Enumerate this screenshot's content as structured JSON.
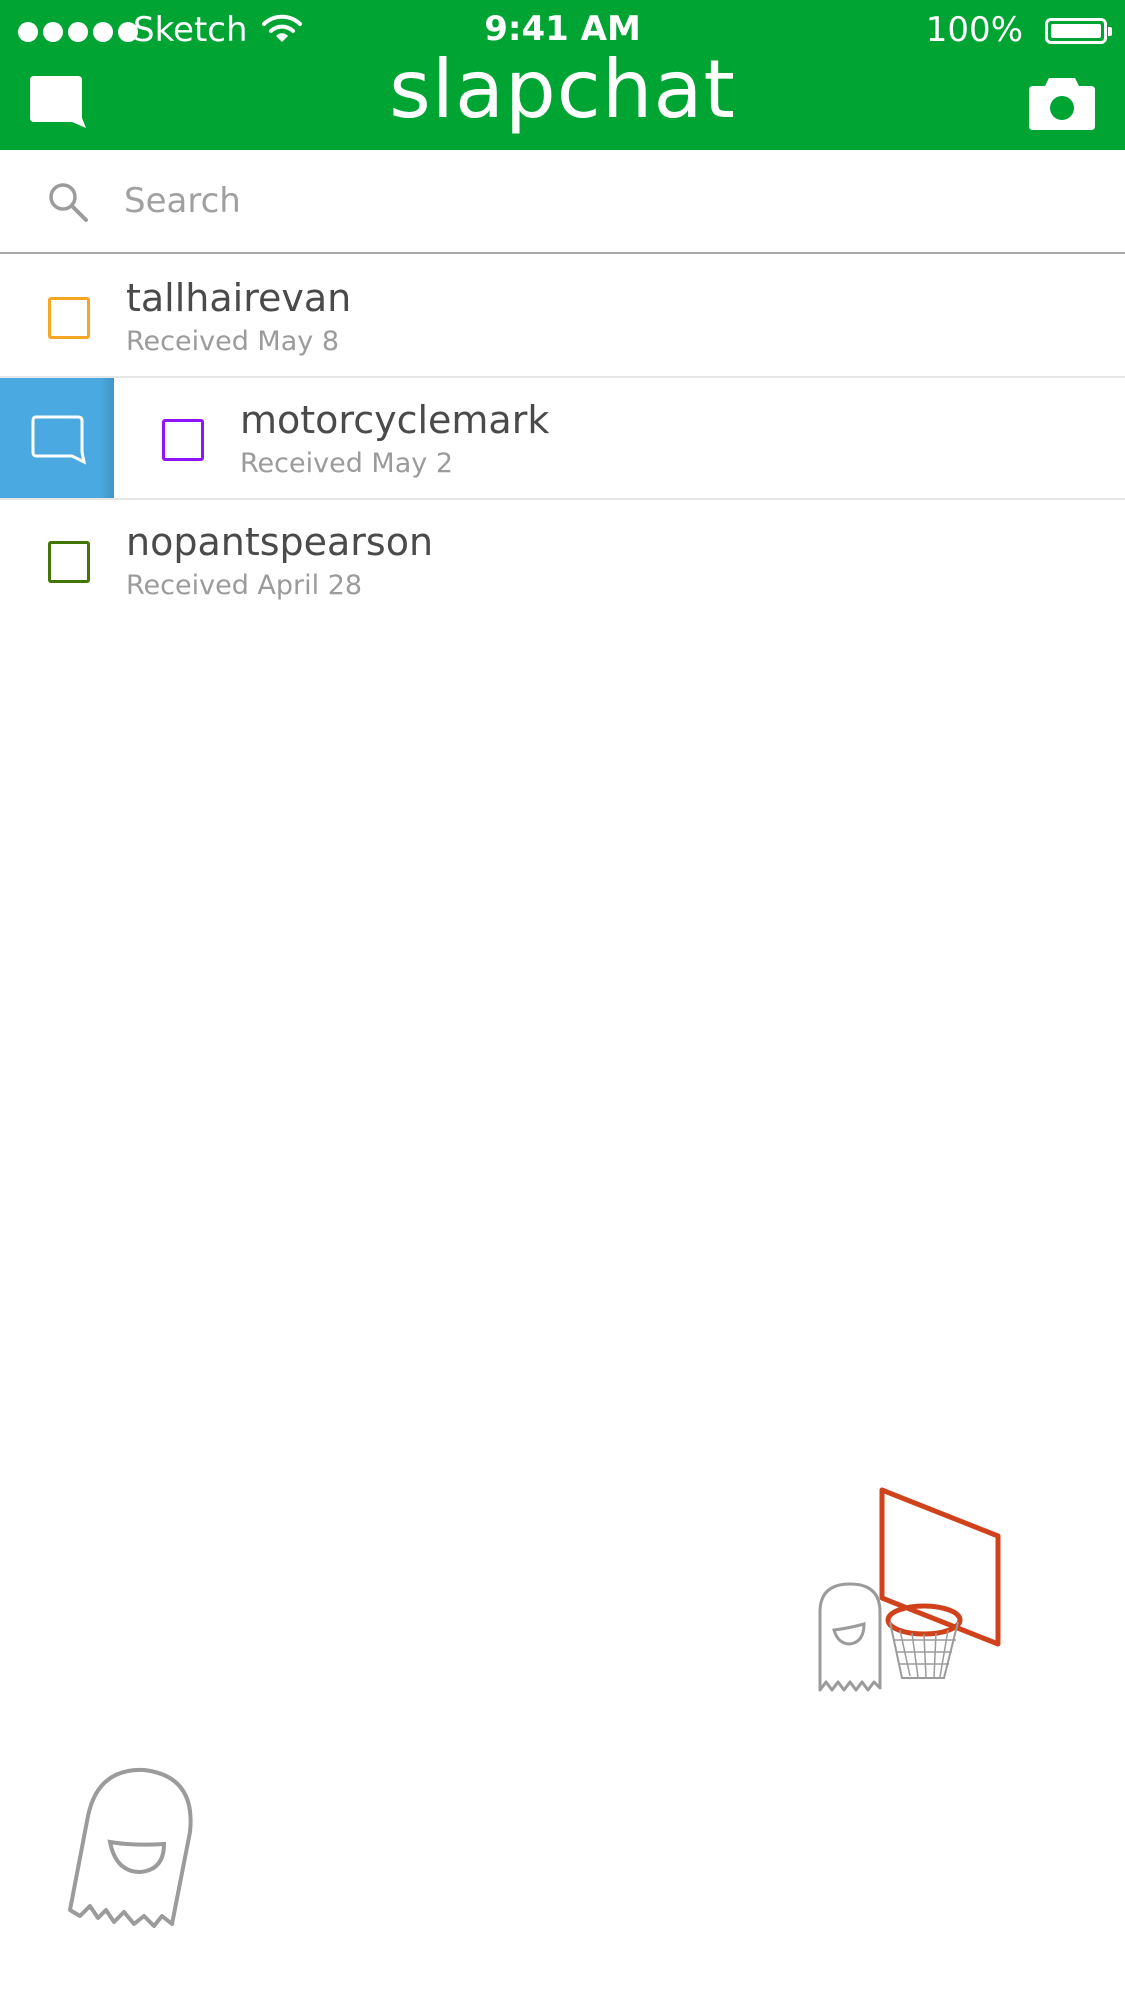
{
  "status_bar": {
    "carrier": "Sketch",
    "time": "9:41 AM",
    "battery": "100%"
  },
  "header": {
    "title": "slapchat",
    "left_icon": "chat-bubble-icon",
    "right_icon": "camera-icon"
  },
  "search": {
    "placeholder": "Search",
    "value": ""
  },
  "conversations": [
    {
      "name": "tallhairevan",
      "status": "Received May 8",
      "color": "#F5A623",
      "swiped": false
    },
    {
      "name": "motorcyclemark",
      "status": "Received May 2",
      "color": "#9013FE",
      "swiped": true,
      "swipe_action_icon": "chat-bubble-outline-icon",
      "swipe_action_color": "#4AA9E1"
    },
    {
      "name": "nopantspearson",
      "status": "Received April 28",
      "color": "#417505",
      "swiped": false
    }
  ],
  "colors": {
    "header": "#00A432",
    "hoop": "#D0421B",
    "ghost": "#9b9b9b"
  }
}
